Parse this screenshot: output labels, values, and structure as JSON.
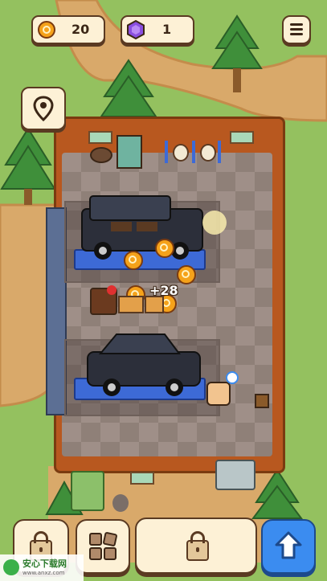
{
  "hud": {
    "coins": "20",
    "gems": "1"
  },
  "floating_reward": "+28",
  "watermark": {
    "title": "安心下载网",
    "url": "www.anxz.com"
  },
  "icons": {
    "coin": "coin-icon",
    "gem": "purple-gem-icon",
    "menu": "hamburger-menu-icon",
    "map": "map-pin-icon",
    "lock": "lock-icon",
    "inventory": "grid-blocks-icon",
    "upgrade": "up-arrow-icon"
  },
  "colors": {
    "accent_blue": "#3b8cf0",
    "coin": "#f5a21a",
    "gem": "#8a4fe0",
    "panel": "#fdf1d6"
  }
}
